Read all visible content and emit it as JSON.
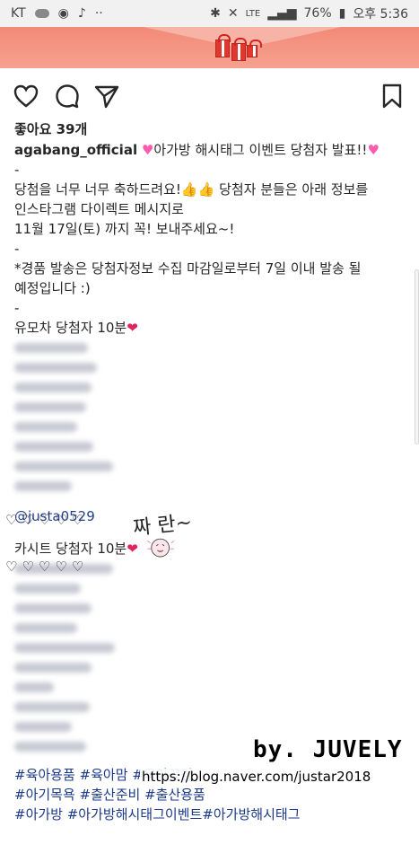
{
  "status_bar": {
    "carrier": "KT",
    "network": "LTE",
    "battery": "76%",
    "time": "오후 5:36"
  },
  "post": {
    "likes": "좋아요 39개",
    "username": "agabang_official",
    "title": "아가방 해시태그 이벤트 당첨자 발표!!",
    "line_dash": "-",
    "congrats": "당첨을 너무 너무 축하드려요!",
    "winners_info": "당첨자 분들은 아래 정보를",
    "winners_info2": "인스타그램 다이렉트 메시지로",
    "deadline": "11월 17일(토) 까지 꼭! 보내주세요~!",
    "notice1": "*경품 발송은 당첨자정보 수집 마감일로부터 7일 이내 발송 될",
    "notice2": "예정입니다 :)",
    "stroller_winners": "유모차 당첨자 10분",
    "mention": "@justa0529",
    "carseat_winners": "카시트 당첨자 10분",
    "hashtag_line1": "#육아용품 #육아맘 #육아공감",
    "hashtag_line2": "#아기목욕 #출산준비 #출산용품",
    "hashtag_line3": "#아가방 #아가방해시태그이벤트#아가방해시태그"
  },
  "overlay": {
    "zzaran": "짜 란~",
    "watermark": "by. JUVELY",
    "watermark_url": "https://blog.naver.com/justar2018"
  },
  "icons": {
    "like": "heart-outline-icon",
    "comment": "comment-bubble-icon",
    "share": "paper-plane-icon",
    "save": "bookmark-icon"
  },
  "colors": {
    "banner": "#f28a76",
    "mention": "#24428c",
    "hashtag": "#1d3a8a"
  }
}
